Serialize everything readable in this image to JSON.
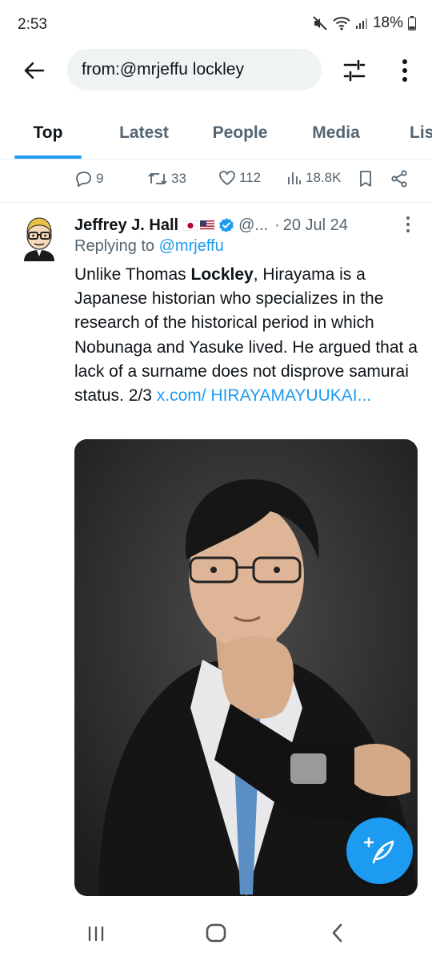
{
  "status": {
    "time": "2:53",
    "battery": "18%"
  },
  "search": {
    "query": "from:@mrjeffu lockley"
  },
  "tabs": [
    "Top",
    "Latest",
    "People",
    "Media",
    "Lis"
  ],
  "prev_tweet_actions": {
    "replies": "9",
    "retweets": "33",
    "likes": "112",
    "views": "18.8K"
  },
  "tweet": {
    "name": "Jeffrey J. Hall",
    "handle": "@...",
    "dot": "·",
    "date": "20 Jul 24",
    "replying_prefix": "Replying to",
    "replying_handle": "@mrjeffu",
    "text_1": "Unlike Thomas ",
    "text_bold": "Lockley",
    "text_2": ", Hirayama is a Japanese historian who specializes in the research of the historical period in which Nobunaga and Yasuke lived. He argued that a lack of a surname does not disprove samurai status. 2/3 ",
    "link_text": "x.com/ HIRAYAMAYUUKAI..."
  },
  "colors": {
    "accent": "#1d9bf0",
    "text": "#0f1419",
    "secondary": "#536471"
  }
}
